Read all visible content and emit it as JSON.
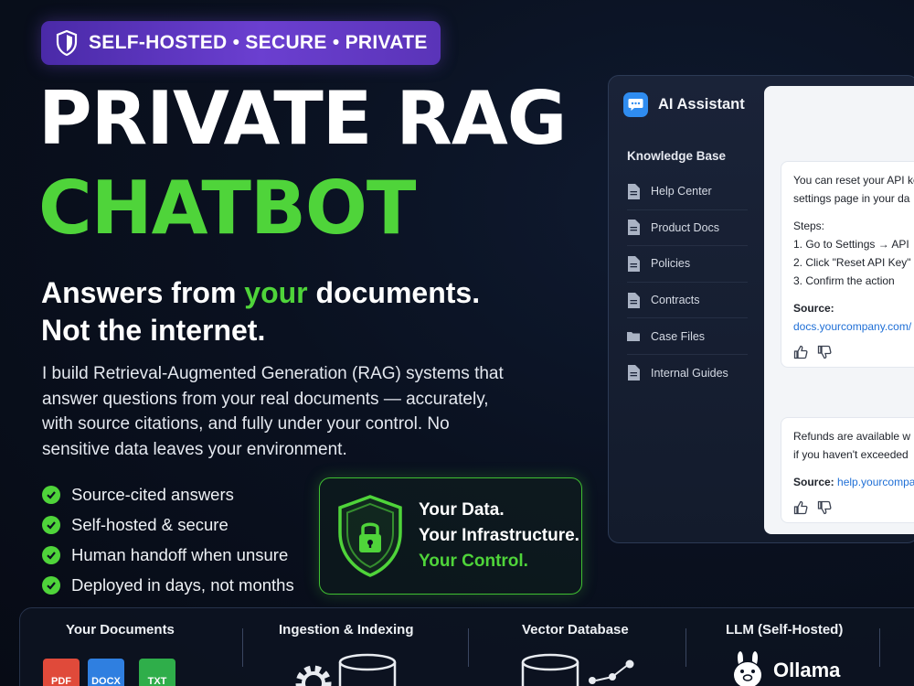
{
  "badge": {
    "text": "SELF-HOSTED • SECURE • PRIVATE",
    "icon": "shield-icon"
  },
  "headline": {
    "line1": "PRIVATE RAG",
    "line2": "CHATBOT"
  },
  "subheadline": {
    "line1_prefix": "Answers from ",
    "line1_highlight": "your",
    "line1_suffix": " documents.",
    "line2": "Not the internet."
  },
  "description": "I build Retrieval-Augmented Generation (RAG) systems that answer questions from your real documents — accurately, with source citations, and fully under your control. No sensitive data leaves your environment.",
  "features": [
    "Source-cited answers",
    "Self-hosted & secure",
    "Human handoff when unsure",
    "Deployed in days, not months"
  ],
  "control_box": {
    "line1": "Your Data.",
    "line2": "Your Infrastructure.",
    "line3": "Your Control."
  },
  "chat": {
    "title": "AI Assistant",
    "kb_heading": "Knowledge Base",
    "kb_items": [
      "Help Center",
      "Product Docs",
      "Policies",
      "Contracts",
      "Case Files",
      "Internal Guides"
    ],
    "message1": {
      "line1": "You can reset your API ke",
      "line2": "settings page in your da",
      "steps_label": "Steps:",
      "step1": "1.  Go to Settings → API",
      "step2": "2.  Click \"Reset API Key\"",
      "step3": "3.  Confirm the action",
      "source_label": "Source:",
      "source_link": "docs.yourcompany.com/"
    },
    "message2": {
      "line1": "Refunds are available w",
      "line2": "if you haven't exceeded",
      "source_label": "Source:",
      "source_link": "help.yourcompa"
    }
  },
  "pipeline": {
    "stages": [
      "Your Documents",
      "Ingestion & Indexing",
      "Vector Database",
      "LLM (Self-Hosted)"
    ],
    "files": [
      "PDF",
      "DOCX",
      "TXT"
    ],
    "llm_name": "Ollama",
    "arrow": "→"
  },
  "colors": {
    "accent_green": "#4fd43a",
    "badge_purple": "#5a34b8",
    "link_blue": "#1f6fd6",
    "background": "#0a1120"
  }
}
